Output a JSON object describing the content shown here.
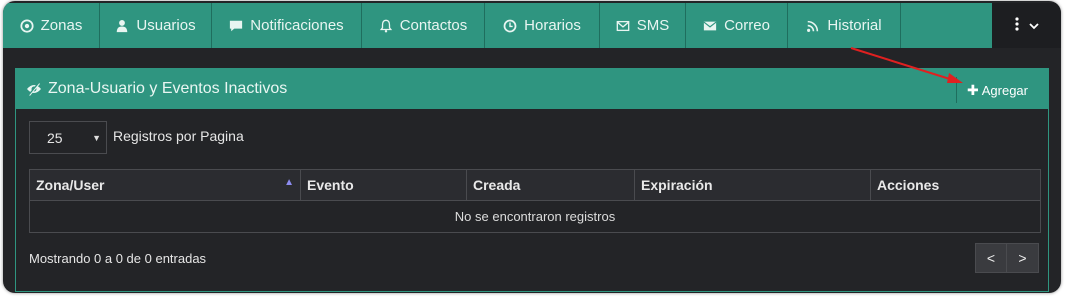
{
  "nav": {
    "tabs": [
      {
        "label": "Zonas",
        "icon": "target-icon"
      },
      {
        "label": "Usuarios",
        "icon": "user-icon"
      },
      {
        "label": "Notificaciones",
        "icon": "comment-icon"
      },
      {
        "label": "Contactos",
        "icon": "bell-icon"
      },
      {
        "label": "Horarios",
        "icon": "clock-icon"
      },
      {
        "label": "SMS",
        "icon": "envelope-outline-icon"
      },
      {
        "label": "Correo",
        "icon": "envelope-icon"
      },
      {
        "label": "Historial",
        "icon": "rss-icon"
      }
    ]
  },
  "panel": {
    "title": "Zona-Usuario y Eventos Inactivos",
    "add_label": "Agregar",
    "page_size": "25",
    "page_size_label": "Registros por Pagina",
    "columns": [
      "Zona/User",
      "Evento",
      "Creada",
      "Expiración",
      "Acciones"
    ],
    "empty_message": "No se encontraron registros",
    "info": "Mostrando 0 a 0 de 0 entradas",
    "prev_label": "<",
    "next_label": ">"
  },
  "colors": {
    "accent": "#2f9580",
    "background": "#232427",
    "annotation_arrow": "#e02020"
  }
}
